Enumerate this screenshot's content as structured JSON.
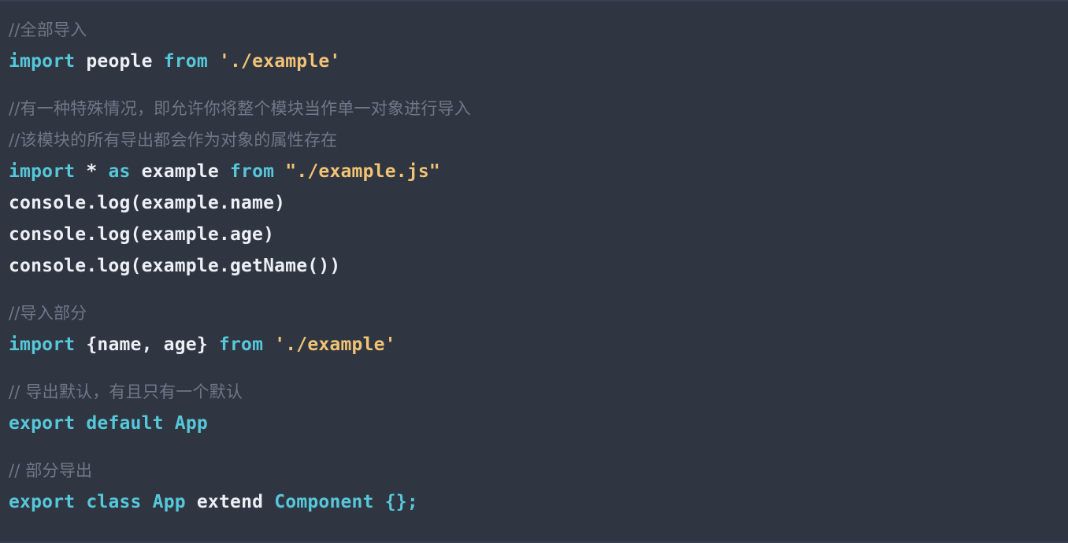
{
  "editor": {
    "background_color": "#2f3642",
    "language": "javascript",
    "comment_color": "#6f7884",
    "keyword_color": "#57c7da",
    "plain_color": "#eceff4",
    "string_color": "#f2c375"
  },
  "lines": [
    {
      "id": "line-1",
      "kind": "comment",
      "text": "//全部导入",
      "tokens": [
        {
          "t": "//全部导入",
          "c": "comment"
        }
      ]
    },
    {
      "id": "line-2",
      "kind": "code",
      "text": "import people from './example'",
      "tokens": [
        {
          "t": "import",
          "c": "keyword"
        },
        {
          "t": " people ",
          "c": "plain"
        },
        {
          "t": "from",
          "c": "keyword"
        },
        {
          "t": " ",
          "c": "plain"
        },
        {
          "t": "'./example'",
          "c": "string"
        }
      ]
    },
    {
      "id": "line-3",
      "kind": "blank",
      "text": "",
      "tokens": []
    },
    {
      "id": "line-4",
      "kind": "comment",
      "text": "//有一种特殊情况，即允许你将整个模块当作单一对象进行导入",
      "tokens": [
        {
          "t": "//有一种特殊情况，即允许你将整个模块当作单一对象进行导入",
          "c": "comment"
        }
      ]
    },
    {
      "id": "line-5",
      "kind": "comment",
      "text": "//该模块的所有导出都会作为对象的属性存在",
      "tokens": [
        {
          "t": "//该模块的所有导出都会作为对象的属性存在",
          "c": "comment"
        }
      ]
    },
    {
      "id": "line-6",
      "kind": "code",
      "text": "import * as example from \"./example.js\"",
      "tokens": [
        {
          "t": "import",
          "c": "keyword"
        },
        {
          "t": " * ",
          "c": "plain"
        },
        {
          "t": "as",
          "c": "keyword"
        },
        {
          "t": " example ",
          "c": "plain"
        },
        {
          "t": "from",
          "c": "keyword"
        },
        {
          "t": " ",
          "c": "plain"
        },
        {
          "t": "\"./example.js\"",
          "c": "string"
        }
      ]
    },
    {
      "id": "line-7",
      "kind": "code",
      "text": "console.log(example.name)",
      "tokens": [
        {
          "t": "console.log(example.name)",
          "c": "plain"
        }
      ]
    },
    {
      "id": "line-8",
      "kind": "code",
      "text": "console.log(example.age)",
      "tokens": [
        {
          "t": "console.log(example.age)",
          "c": "plain"
        }
      ]
    },
    {
      "id": "line-9",
      "kind": "code",
      "text": "console.log(example.getName())",
      "tokens": [
        {
          "t": "console.log(example.getName())",
          "c": "plain"
        }
      ]
    },
    {
      "id": "line-10",
      "kind": "blank",
      "text": "",
      "tokens": []
    },
    {
      "id": "line-11",
      "kind": "comment",
      "text": "//导入部分",
      "tokens": [
        {
          "t": "//导入部分",
          "c": "comment"
        }
      ]
    },
    {
      "id": "line-12",
      "kind": "code",
      "text": "import {name, age} from './example'",
      "tokens": [
        {
          "t": "import",
          "c": "keyword"
        },
        {
          "t": " {name, age} ",
          "c": "plain"
        },
        {
          "t": "from",
          "c": "keyword"
        },
        {
          "t": " ",
          "c": "plain"
        },
        {
          "t": "'./example'",
          "c": "string"
        }
      ]
    },
    {
      "id": "line-13",
      "kind": "blank",
      "text": "",
      "tokens": []
    },
    {
      "id": "line-14",
      "kind": "comment",
      "text": "// 导出默认，有且只有一个默认",
      "tokens": [
        {
          "t": "// 导出默认，有且只有一个默认",
          "c": "comment"
        }
      ]
    },
    {
      "id": "line-15",
      "kind": "code",
      "text": "export default App",
      "tokens": [
        {
          "t": "export",
          "c": "keyword"
        },
        {
          "t": " ",
          "c": "plain"
        },
        {
          "t": "default",
          "c": "keyword"
        },
        {
          "t": " ",
          "c": "plain"
        },
        {
          "t": "App",
          "c": "type"
        }
      ]
    },
    {
      "id": "line-16",
      "kind": "blank",
      "text": "",
      "tokens": []
    },
    {
      "id": "line-17",
      "kind": "comment",
      "text": "// 部分导出",
      "tokens": [
        {
          "t": "// 部分导出",
          "c": "comment"
        }
      ]
    },
    {
      "id": "line-18",
      "kind": "code",
      "text": "export class App extend Component {};",
      "tokens": [
        {
          "t": "export",
          "c": "keyword"
        },
        {
          "t": " ",
          "c": "plain"
        },
        {
          "t": "class",
          "c": "keyword"
        },
        {
          "t": " ",
          "c": "plain"
        },
        {
          "t": "App",
          "c": "type"
        },
        {
          "t": " extend ",
          "c": "plain"
        },
        {
          "t": "Component",
          "c": "type"
        },
        {
          "t": " ",
          "c": "plain"
        },
        {
          "t": "{};",
          "c": "punct"
        }
      ]
    }
  ]
}
